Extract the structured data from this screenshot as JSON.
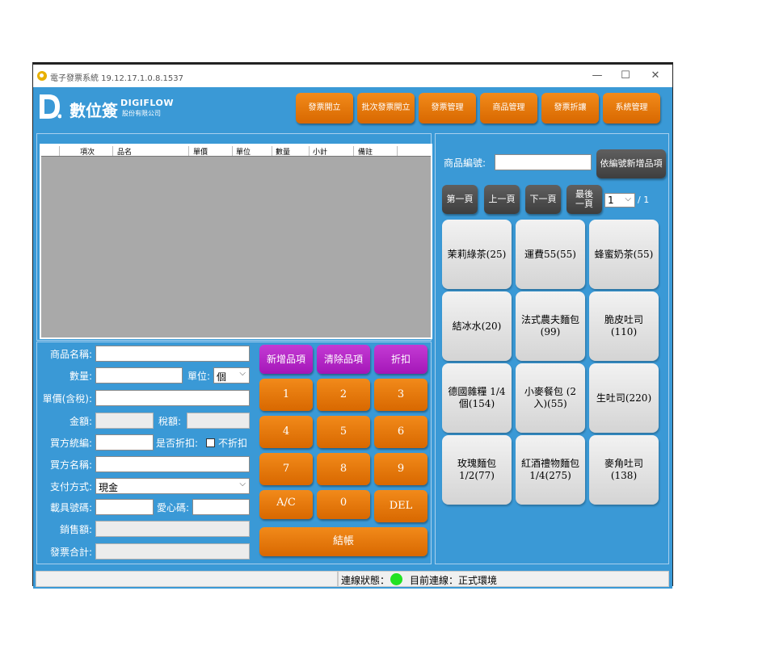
{
  "window": {
    "title": "電子發票系統 19.12.17.1.0.8.1537",
    "controls": {
      "minimize": "—",
      "maximize": "☐",
      "close": "✕"
    }
  },
  "header": {
    "logo_cn": "數位簽",
    "logo_en": "DIGIFLOW",
    "logo_en_sub": "股份有限公司",
    "buttons": [
      "發票開立",
      "批次發票開立",
      "發票管理",
      "商品管理",
      "發票折讓",
      "系統管理"
    ]
  },
  "grid": {
    "columns": [
      "項次",
      "品名",
      "單價",
      "單位",
      "數量",
      "小計",
      "備註"
    ]
  },
  "form": {
    "product_name_label": "商品名稱:",
    "product_name_value": "",
    "quantity_label": "數量:",
    "quantity_value": "",
    "unit_label": "單位:",
    "unit_value": "個",
    "unit_price_label": "單價(含稅):",
    "unit_price_value": "",
    "amount_label": "金額:",
    "amount_value": "",
    "tax_label": "稅額:",
    "tax_value": "",
    "buyer_id_label": "買方統編:",
    "buyer_id_value": "",
    "discount_label": "是否折扣:",
    "no_discount_label": "不折扣",
    "buyer_name_label": "買方名稱:",
    "buyer_name_value": "",
    "payment_label": "支付方式:",
    "payment_value": "現金",
    "carrier_label": "載具號碼:",
    "carrier_value": "",
    "love_code_label": "愛心碼:",
    "love_code_value": "",
    "sales_label": "銷售額:",
    "sales_value": "",
    "total_label": "發票合計:",
    "total_value": ""
  },
  "actions": {
    "add_item": "新增品項",
    "clear_item": "清除品項",
    "discount": "折扣",
    "checkout": "結帳"
  },
  "keypad": [
    "1",
    "2",
    "3",
    "4",
    "5",
    "6",
    "7",
    "8",
    "9",
    "A/C",
    "0",
    "DEL"
  ],
  "product_panel": {
    "code_label": "商品編號:",
    "code_value": "",
    "add_by_code": "依編號新增品項",
    "first_page": "第一頁",
    "prev_page": "上一頁",
    "next_page": "下一頁",
    "last_page": "最後一頁",
    "page_value": "1",
    "page_total": "/ 1",
    "products": [
      "茉莉綠茶(25)",
      "運費55(55)",
      "蜂蜜奶茶(55)",
      "結冰水(20)",
      "法式農夫麵包(99)",
      "脆皮吐司(110)",
      "德國雜糧 1/4個(154)",
      "小麥餐包 (2入)(55)",
      "生吐司(220)",
      "玫瑰麵包 1/2(77)",
      "紅酒禮物麵包 1/4(275)",
      "麥角吐司(138)"
    ]
  },
  "status": {
    "left_text": "",
    "connection_label": "連線狀態：",
    "current_connection": "目前連線：正式環境"
  },
  "colors": {
    "accent_blue": "#3a99d6",
    "orange": "#e87a0a",
    "purple": "#b42ac6",
    "status_green": "#22e222"
  }
}
